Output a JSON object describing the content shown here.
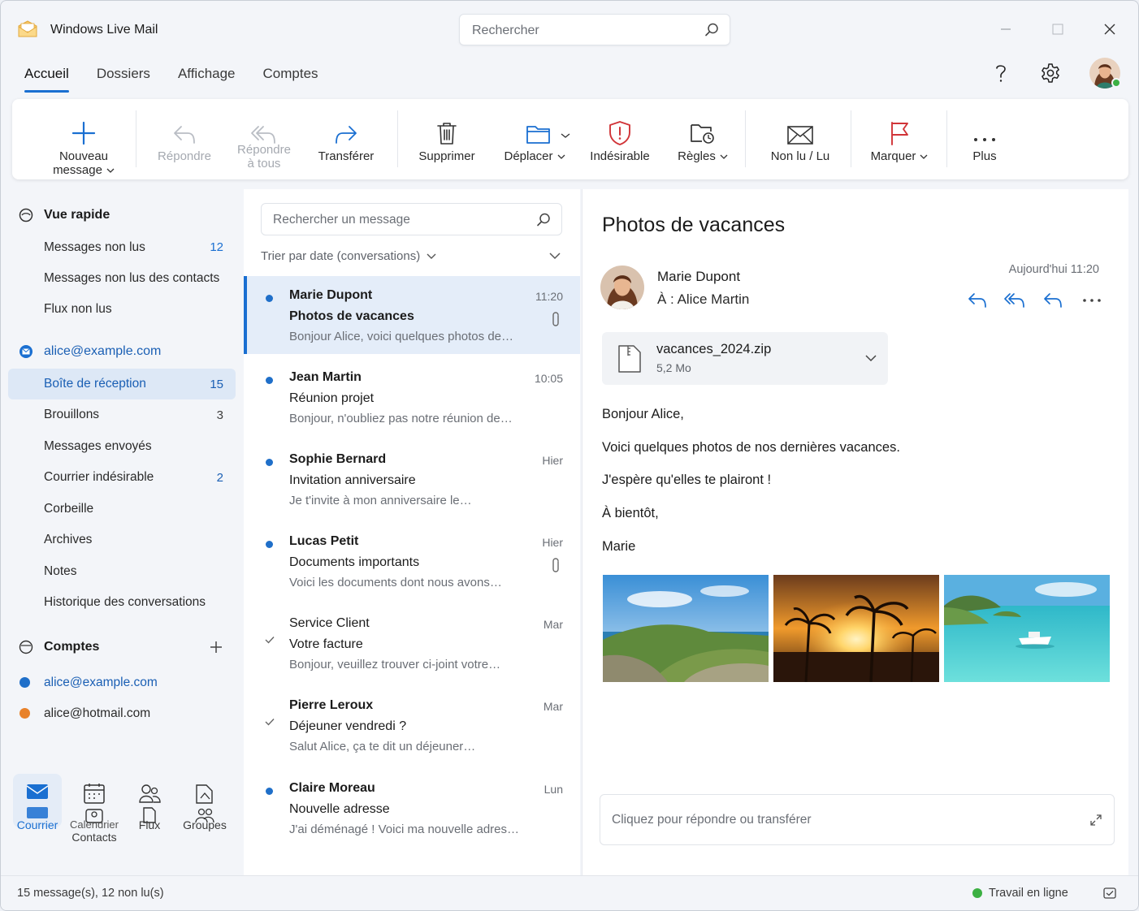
{
  "app": {
    "title": "Windows Live Mail"
  },
  "search": {
    "placeholder": "Rechercher"
  },
  "tabs": [
    {
      "label": "Accueil",
      "active": true
    },
    {
      "label": "Dossiers"
    },
    {
      "label": "Affichage"
    },
    {
      "label": "Comptes"
    }
  ],
  "header_icons": [
    "help-icon",
    "settings-gear-icon",
    "user-avatar"
  ],
  "ribbon": {
    "new_line1": "Nouveau",
    "new_line2": "message",
    "reply": "Répondre",
    "reply_all_line1": "Répondre",
    "reply_all_line2": "à tous",
    "forward": "Transférer",
    "delete": "Supprimer",
    "move": "Déplacer",
    "junk": "Indésirable",
    "rules": "Règles",
    "read_unread": "Non lu / Lu",
    "flag": "Marquer",
    "more": "Plus"
  },
  "nav": {
    "quick_view": "Vue rapide",
    "quick_items": [
      {
        "label": "Messages non lus",
        "count": "12"
      },
      {
        "label": "Messages non lus des contacts",
        "count": ""
      },
      {
        "label": "Flux non lus",
        "count": ""
      }
    ],
    "account": "alice@example.com",
    "folders": [
      {
        "label": "Boîte de réception",
        "count": "15",
        "selected": true
      },
      {
        "label": "Brouillons",
        "count": "3"
      },
      {
        "label": "Messages envoyés",
        "count": ""
      },
      {
        "label": "Courrier indésirable",
        "count": "2"
      },
      {
        "label": "Corbeille",
        "count": ""
      },
      {
        "label": "Archives",
        "count": ""
      },
      {
        "label": "Notes",
        "count": ""
      },
      {
        "label": "Historique des conversations",
        "count": ""
      }
    ],
    "accounts_title": "Comptes",
    "accounts": [
      {
        "label": "alice@example.com",
        "color": "#1f6fc9"
      },
      {
        "label": "alice@hotmail.com",
        "color": "#e8822a"
      }
    ],
    "apps": {
      "mail": "Courrier",
      "calendar": "Calendrier",
      "contacts": "Contacts",
      "feeds": "Flux",
      "groups": "Groupes"
    }
  },
  "list": {
    "search_placeholder": "Rechercher un message",
    "sort_label": "Trier par date (conversations)",
    "messages": [
      {
        "from": "Marie Dupont",
        "subject": "Photos de vacances",
        "preview": "Bonjour Alice, voici quelques photos de…",
        "time": "11:20",
        "unread": true,
        "attachment": true,
        "selected": true
      },
      {
        "from": "Jean Martin",
        "subject": "Réunion projet",
        "preview": "Bonjour, n'oubliez pas notre réunion de…",
        "time": "10:05",
        "unread": true,
        "attachment": false
      },
      {
        "from": "Sophie Bernard",
        "subject": "Invitation anniversaire",
        "preview": "Je t'invite à mon anniversaire le…",
        "time": "Hier",
        "unread": true,
        "attachment": false
      },
      {
        "from": "Lucas Petit",
        "subject": "Documents importants",
        "preview": "Voici les documents dont nous avons…",
        "time": "Hier",
        "unread": true,
        "attachment": true
      },
      {
        "from": "Service Client",
        "subject": "Votre facture",
        "preview": "Bonjour, veuillez trouver ci-joint votre…",
        "time": "Mar",
        "unread": false,
        "replied": true,
        "attachment": false
      },
      {
        "from": "Pierre Leroux",
        "subject": "Déjeuner vendredi ?",
        "preview": "Salut Alice, ça te dit un déjeuner…",
        "time": "Mar",
        "unread": false,
        "replied": true,
        "attachment": false
      },
      {
        "from": "Claire Moreau",
        "subject": "Nouvelle adresse",
        "preview": "J'ai déménagé ! Voici ma nouvelle adresse :…",
        "time": "Lun",
        "unread": true,
        "attachment": false
      }
    ]
  },
  "reading": {
    "title": "Photos de vacances",
    "from": "Marie Dupont",
    "to": "À : Alice Martin",
    "date": "Aujourd'hui 11:20",
    "attachment": {
      "name": "vacances_2024.zip",
      "size": "5,2 Mo"
    },
    "body": [
      "Bonjour Alice,",
      "Voici quelques photos de nos dernières vacances.",
      "J'espère qu'elles te plairont !",
      "À bientôt,",
      "Marie"
    ],
    "photos": [
      "coastline-photo",
      "sunset-palms-photo",
      "lagoon-boat-photo"
    ],
    "reply_placeholder": "Cliquez pour répondre ou transférer"
  },
  "status": {
    "left": "15 message(s), 12 non lu(s)",
    "right": "Travail en ligne"
  },
  "colors": {
    "accent": "#1a6fd1",
    "junk": "#d13438",
    "online": "#3cb043"
  }
}
